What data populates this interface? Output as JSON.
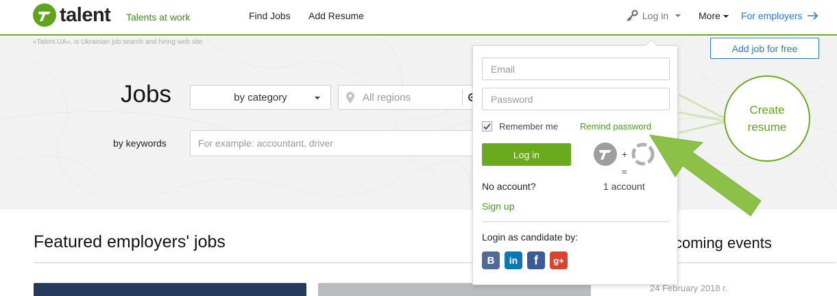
{
  "header": {
    "logo_text": "talent",
    "tagline": "Talents at work",
    "nav": {
      "find_jobs": "Find Jobs",
      "add_resume": "Add Resume"
    },
    "login": "Log in",
    "more": "More",
    "for_employers": "For employers"
  },
  "hero": {
    "site_note": "«Talent.UA», is Ukrainian job search and hiring web site",
    "title": "Jobs",
    "category_select": "by category",
    "region_placeholder": "All regions",
    "keywords_label": "by keywords",
    "keywords_placeholder": "For example: accountant, driver",
    "add_job_button": "Add job for free",
    "create_resume": "Create resume"
  },
  "login_popup": {
    "email_placeholder": "Email",
    "password_placeholder": "Password",
    "remember_me": "Remember me",
    "remind_password": "Remind password",
    "login_button": "Log in",
    "no_account": "No account?",
    "sign_up": "Sign up",
    "plus": "+",
    "equals": "=",
    "one_account": "1 account",
    "social_title": "Login as candidate by:",
    "socials": [
      {
        "name": "vk",
        "glyph": "B",
        "color": "#4f6b95"
      },
      {
        "name": "linkedin",
        "glyph": "in",
        "color": "#0b77b5"
      },
      {
        "name": "facebook",
        "glyph": "f",
        "color": "#3b5a9a"
      },
      {
        "name": "google-plus",
        "glyph": "g+",
        "color": "#d9442f"
      }
    ]
  },
  "sections": {
    "featured_title": "Featured employers' jobs",
    "events_title": "coming events",
    "event_date": "24 February 2018 г."
  },
  "colors": {
    "brand_green": "#6aab1e",
    "link_blue": "#2879c8",
    "arrow_green": "#8cc046"
  }
}
